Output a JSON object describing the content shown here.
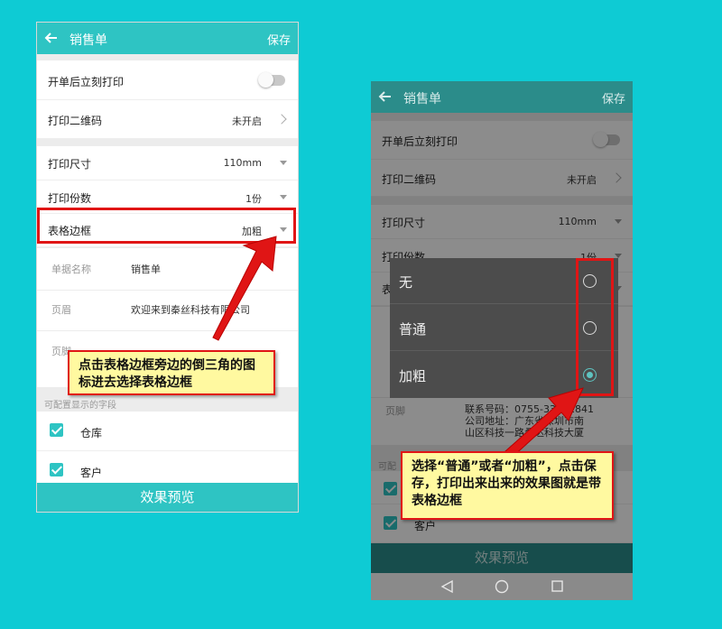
{
  "phone1": {
    "appbar": {
      "title": "销售单",
      "save_label": "保存"
    },
    "rows": {
      "print_now": "开单后立刻打印",
      "qr_label": "打印二维码",
      "qr_value": "未开启",
      "size_label": "打印尺寸",
      "size_value": "110mm",
      "copies_label": "打印份数",
      "copies_value": "1份",
      "border_label": "表格边框",
      "border_value": "加粗"
    },
    "fields": {
      "doc_name_label": "单据名称",
      "doc_name_value": "销售单",
      "header_label": "页眉",
      "header_value": "欢迎来到秦丝科技有限公司",
      "footer_label": "页脚"
    },
    "section_title": "可配置显示的字段",
    "checks": {
      "warehouse": "仓库",
      "customer": "客户"
    },
    "preview_label": "效果预览"
  },
  "phone2": {
    "appbar": {
      "title": "销售单",
      "save_label": "保存"
    },
    "rows": {
      "print_now": "开单后立刻打印",
      "qr_label": "打印二维码",
      "qr_value": "未开启",
      "size_label": "打印尺寸",
      "size_value": "110mm",
      "copies_label": "打印份数",
      "copies_value": "1份",
      "border_label": "表"
    },
    "fields": {
      "footer_label": "页脚",
      "footer_value": "联系号码：0755-33201841\n公司地址：广东省深圳市南\n山区科技一路桑达科技大厦"
    },
    "section_title": "可配",
    "checks": {
      "customer": "客户"
    },
    "dialog": {
      "options": [
        "无",
        "普通",
        "加粗"
      ],
      "selected_index": 2
    },
    "preview_label": "效果预览"
  },
  "callouts": {
    "left": "点击表格边框旁边的倒三角的图标进去选择表格边框",
    "right": "选择“普通”或者“加粗”，点击保存，打印出来出来的效果图就是带表格边框"
  },
  "colors": {
    "accent": "#2ec4c3",
    "accent_dim": "#2b8c8a",
    "highlight": "#e01515",
    "callout_bg": "#fff9a0",
    "background": "#0ecbd4"
  }
}
